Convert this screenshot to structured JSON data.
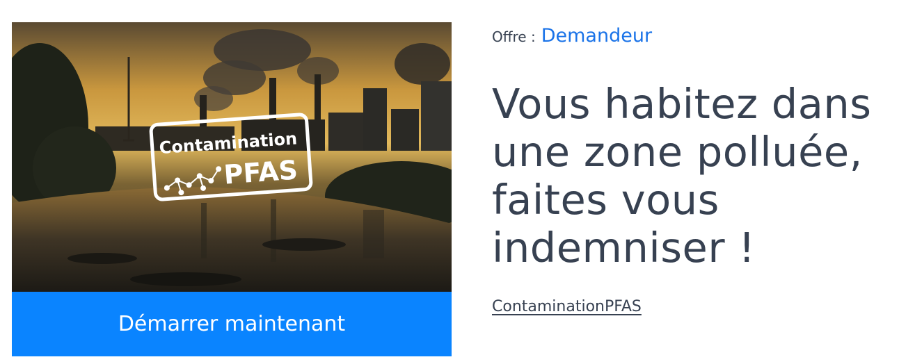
{
  "offer": {
    "label": "Offre :",
    "value": "Demandeur"
  },
  "headline": "Vous habitez dans une zone polluée, faites vous indemniser !",
  "tag": "ContaminationPFAS",
  "hero": {
    "badge_line1": "Contamination",
    "badge_line2": "PFAS"
  },
  "cta": {
    "label": "Démarrer maintenant"
  },
  "colors": {
    "accent": "#0a84ff",
    "link": "#1a73e8",
    "text": "#374151"
  }
}
